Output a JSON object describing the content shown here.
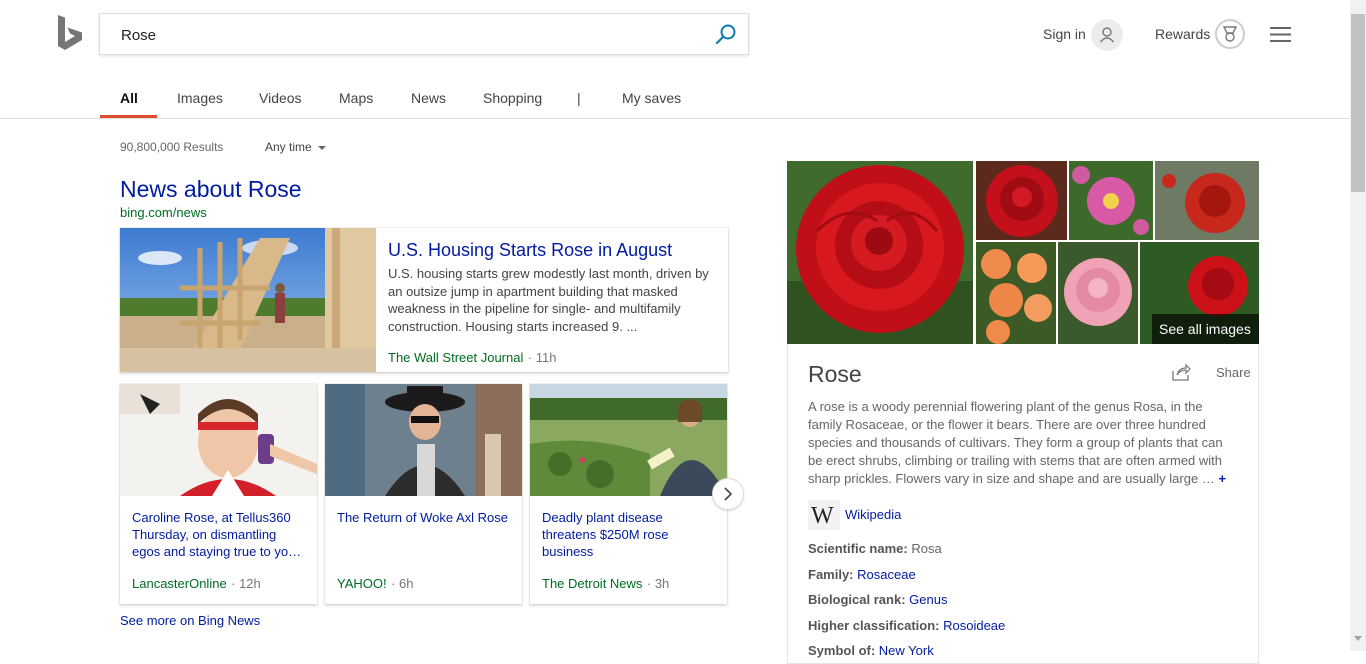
{
  "search": {
    "query": "Rose"
  },
  "header": {
    "signin_label": "Sign in",
    "rewards_label": "Rewards"
  },
  "tabs": [
    {
      "label": "All",
      "active": true
    },
    {
      "label": "Images"
    },
    {
      "label": "Videos"
    },
    {
      "label": "Maps"
    },
    {
      "label": "News"
    },
    {
      "label": "Shopping"
    },
    {
      "label": "|"
    },
    {
      "label": "My saves"
    }
  ],
  "results": {
    "count": "90,800,000 Results",
    "time_filter": "Any time"
  },
  "news": {
    "title": "News about Rose",
    "url": "bing.com/news",
    "main": {
      "headline": "U.S. Housing Starts Rose in August",
      "snippet": "U.S. housing starts grew modestly last month, driven by an outsize jump in apartment building that masked weakness in the pipeline for single- and multifamily construction. Housing starts increased 9. ...",
      "source": "The Wall Street Journal",
      "age": "· 11h"
    },
    "cards": [
      {
        "headline": "Caroline Rose, at Tellus360 Thursday, on dismantling egos and staying true to yo…",
        "source": "LancasterOnline",
        "age": "· 12h"
      },
      {
        "headline": "The Return of Woke Axl Rose",
        "source": "YAHOO!",
        "age": "· 6h"
      },
      {
        "headline": "Deadly plant disease threatens $250M rose business",
        "source": "The Detroit News",
        "age": "· 3h"
      }
    ],
    "see_more": "See more on Bing News"
  },
  "knowledge_panel": {
    "see_all_images": "See all images",
    "title": "Rose",
    "share_label": "Share",
    "description": "A rose is a woody perennial flowering plant of the genus Rosa, in the family Rosaceae, or the flower it bears. There are over three hundred species and thousands of cultivars. They form a group of plants that can be erect shrubs, climbing or trailing with stems that are often armed with sharp prickles. Flowers vary in size and shape and are usually large …",
    "more_symbol": "+",
    "wiki_label": "Wikipedia",
    "facts": [
      {
        "label": "Scientific name:",
        "value": "Rosa",
        "link": false
      },
      {
        "label": "Family:",
        "value": "Rosaceae",
        "link": true
      },
      {
        "label": "Biological rank:",
        "value": "Genus",
        "link": true
      },
      {
        "label": "Higher classification:",
        "value": "Rosoideae",
        "link": true
      },
      {
        "label": "Symbol of:",
        "value": "New York",
        "link": true
      }
    ]
  },
  "colors": {
    "link": "#001ba0",
    "source": "#006d21",
    "accent": "#de4c32"
  }
}
